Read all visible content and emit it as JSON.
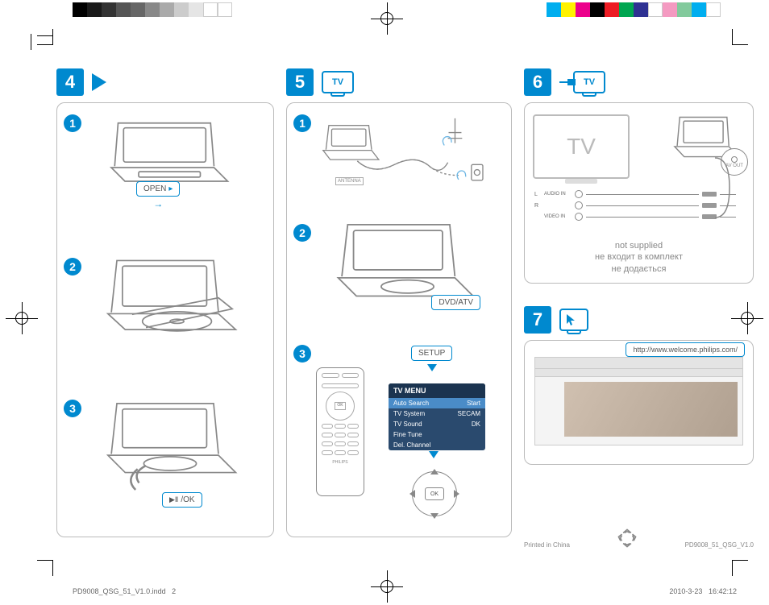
{
  "sections": {
    "s4": {
      "number": "4"
    },
    "s5": {
      "number": "5",
      "tv_label": "TV"
    },
    "s6": {
      "number": "6",
      "tv_label": "TV"
    },
    "s7": {
      "number": "7"
    }
  },
  "col1": {
    "step1": "1",
    "step2": "2",
    "step3": "3",
    "open_label": "OPEN",
    "play_ok_label": "/OK"
  },
  "col2": {
    "step1": "1",
    "step2": "2",
    "step3": "3",
    "antenna_label": "ANTENNA",
    "dvd_atv_label": "DVD/ATV",
    "setup_label": "SETUP",
    "remote_brand": "PHILIPS",
    "dpad_ok": "OK",
    "tv_menu": {
      "title": "TV MENU",
      "rows": [
        {
          "l": "Auto Search",
          "r": "Start"
        },
        {
          "l": "TV System",
          "r": "SECAM"
        },
        {
          "l": "TV Sound",
          "r": "DK"
        },
        {
          "l": "Fine Tune",
          "r": ""
        },
        {
          "l": "Del. Channel",
          "r": ""
        }
      ]
    }
  },
  "panel6": {
    "tv_text": "TV",
    "avout_label": "AV OUT",
    "jacks": [
      {
        "label": "L",
        "sub": "AUDIO IN"
      },
      {
        "label": "R",
        "sub": ""
      },
      {
        "label": "",
        "sub": "VIDEO IN"
      }
    ],
    "not_supplied": "not supplied",
    "not_supplied_ru": "не входит в комплект",
    "not_supplied_uk": "не додається"
  },
  "panel7": {
    "url": "http://www.welcome.philips.com/"
  },
  "footer": {
    "printed": "Printed in China",
    "model": "PD9008_51_QSG_V1.0"
  },
  "imprint": {
    "file": "PD9008_QSG_51_V1.0.indd",
    "page": "2",
    "date": "2010-3-23",
    "time": "16:42:12"
  },
  "colorbar1": [
    "#000",
    "#1a1a1a",
    "#333",
    "#555",
    "#666",
    "#888",
    "#aaa",
    "#ccc",
    "#e5e5e5",
    "#fff",
    "#fff"
  ],
  "colorbar2": [
    "#00aeef",
    "#fff200",
    "#ec008c",
    "#000",
    "#ed1c24",
    "#00a651",
    "#2e3192",
    "#fff",
    "#f49ac1",
    "#82ca9c",
    "#00aeef",
    "#fff"
  ]
}
